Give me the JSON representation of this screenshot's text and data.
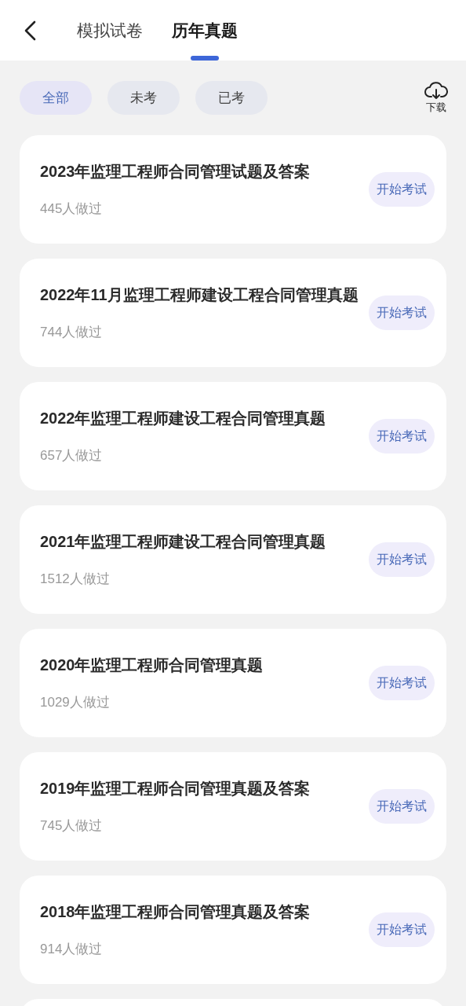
{
  "tabs": [
    {
      "label": "模拟试卷",
      "selected": false
    },
    {
      "label": "历年真题",
      "selected": true
    }
  ],
  "filters": [
    {
      "label": "全部",
      "selected": true
    },
    {
      "label": "未考",
      "selected": false
    },
    {
      "label": "已考",
      "selected": false
    }
  ],
  "download": {
    "label": "下载"
  },
  "papers": [
    {
      "title": "2023年监理工程师合同管理试题及答案",
      "count": "445人做过",
      "action": "开始考试"
    },
    {
      "title": "2022年11月监理工程师建设工程合同管理真题",
      "count": "744人做过",
      "action": "开始考试"
    },
    {
      "title": "2022年监理工程师建设工程合同管理真题",
      "count": "657人做过",
      "action": "开始考试"
    },
    {
      "title": "2021年监理工程师建设工程合同管理真题",
      "count": "1512人做过",
      "action": "开始考试"
    },
    {
      "title": "2020年监理工程师合同管理真题",
      "count": "1029人做过",
      "action": "开始考试"
    },
    {
      "title": "2019年监理工程师合同管理真题及答案",
      "count": "745人做过",
      "action": "开始考试"
    },
    {
      "title": "2018年监理工程师合同管理真题及答案",
      "count": "914人做过",
      "action": "开始考试"
    }
  ]
}
